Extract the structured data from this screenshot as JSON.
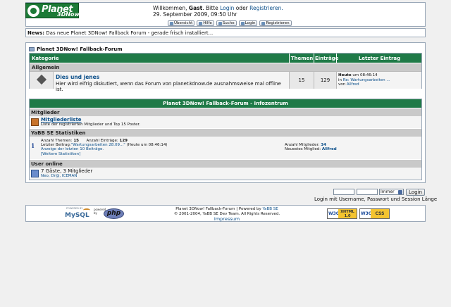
{
  "logo": {
    "main": "Planet",
    "sub": "3DNow!"
  },
  "welcome": {
    "prefix": "Willkommen,",
    "guest": "Gast",
    "mid": ". Bitte",
    "login": "Login",
    "or": "oder",
    "register": "Registrieren.",
    "datetime": "29. September 2009, 09:50 Uhr"
  },
  "toolbar": [
    "Übersicht",
    "Hilfe",
    "Suche",
    "Login",
    "Registrieren"
  ],
  "news": {
    "label": "News:",
    "text": "Das neue Planet 3DNow! Fallback Forum - gerade frisch installiert..."
  },
  "breadcrumb": "Planet 3DNow! Fallback-Forum",
  "board_table": {
    "headers": {
      "category": "Kategorie",
      "topics": "Themen",
      "posts": "Einträge",
      "last": "Letzter Eintrag"
    },
    "category": "Allgemein",
    "board": {
      "name": "Dies und jenes",
      "desc": "Hier wird eifrig diskutiert, wenn das Forum von planet3dnow.de ausnahmsweise mal offline ist.",
      "topics": "15",
      "posts": "129",
      "last_when": "Heute",
      "last_time": "um 08:46:14",
      "last_in": "in",
      "last_thread": "Re: Wartungsarbeiten ...",
      "last_by": "von",
      "last_user": "Allfred"
    }
  },
  "info": {
    "title": "Planet 3DNow! Fallback-Forum - Infozentrum",
    "members_header": "Mitglieder",
    "memberlist_link": "Mitgliederliste",
    "memberlist_desc": "Liste der registrierten Mitglieder und Top 15 Poster.",
    "stats_header": "YaBB SE Statistiken",
    "stats": {
      "topics_label": "Anzahl Themen:",
      "topics_val": "15",
      "posts_label": "Anzahl Einträge:",
      "posts_val": "129",
      "last_label": "Letzter Beitrag:",
      "last_thread": "\"Wartungsarbeiten 28.09...\"",
      "last_when": "(Heute",
      "last_time": "um 08:46:14)",
      "latest_link": "Anzeige der letzten 10 Beiträge.",
      "more_link": "[Weitere Statistiken]",
      "members_label": "Anzahl Mitglieder:",
      "members_val": "34",
      "newest_label": "Neuestes Mitglied:",
      "newest_val": "Allfred"
    },
    "online_header": "User online",
    "online_summary": "7 Gäste, 3 Mitglieder",
    "online_users": "Neo, Dr@, ICEMAN"
  },
  "login_bar": {
    "duration": "Immer",
    "button": "Login",
    "hint": "Login mit Username, Passwort und Session Länge"
  },
  "footer": {
    "line1": "Planet 3DNow! Fallback-Forum | Powered by",
    "yabb": "YaBB SE",
    "line2": "© 2001-2004, YaBB SE Dev Team. All Rights Reserved.",
    "impressum": "Impressum",
    "mysql_powered": "POWERED BY",
    "mysql": "MySQL",
    "php_powered": "powered by",
    "php": "php",
    "xhtml": "XHTML 1.0",
    "css": "CSS",
    "w3c": "W3C"
  }
}
